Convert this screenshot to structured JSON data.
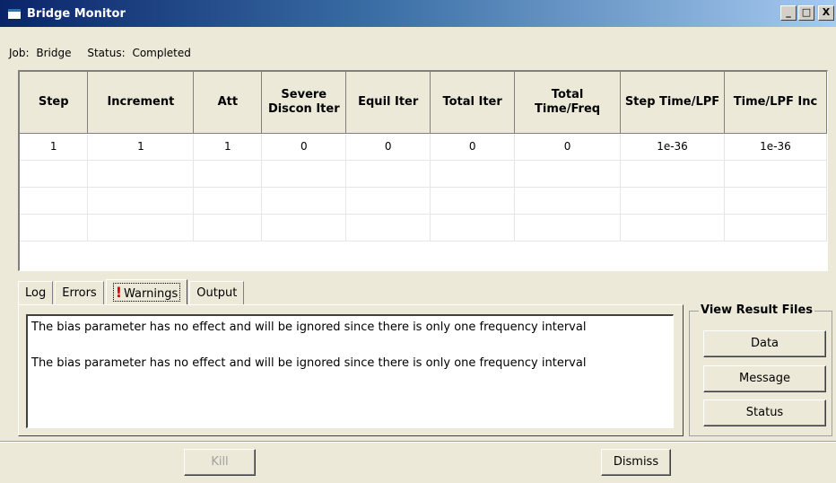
{
  "window": {
    "title": "Bridge Monitor",
    "controls": {
      "minimize": "_",
      "maximize": "□",
      "close": "X"
    }
  },
  "status_line": {
    "job_label": "Job:",
    "job_value": "Bridge",
    "status_label": "Status:",
    "status_value": "Completed"
  },
  "grid": {
    "columns": [
      "Step",
      "Increment",
      "Att",
      "Severe Discon Iter",
      "Equil Iter",
      "Total Iter",
      "Total Time/Freq",
      "Step Time/LPF",
      "Time/LPF Inc"
    ],
    "rows": [
      [
        "1",
        "1",
        "1",
        "0",
        "0",
        "0",
        "0",
        "1e-36",
        "1e-36"
      ]
    ]
  },
  "tabs": [
    {
      "label": "Log"
    },
    {
      "label": "Errors"
    },
    {
      "label": "Warnings",
      "icon": "exclamation-icon",
      "active": true
    },
    {
      "label": "Output"
    }
  ],
  "warnings": [
    "The bias parameter has no effect and will be ignored since there is only one frequency interval",
    "The bias parameter has no effect and will be ignored since there is only one frequency interval"
  ],
  "result_files": {
    "title": "View Result Files",
    "buttons": [
      "Data",
      "Message",
      "Status"
    ]
  },
  "actions": {
    "kill_label": "Kill",
    "dismiss_label": "Dismiss"
  },
  "colors": {
    "titlebar_start": "#0a246a",
    "titlebar_end": "#a6caf0",
    "dialog_bg": "#ece9d8",
    "warning_mark": "#e00000"
  }
}
